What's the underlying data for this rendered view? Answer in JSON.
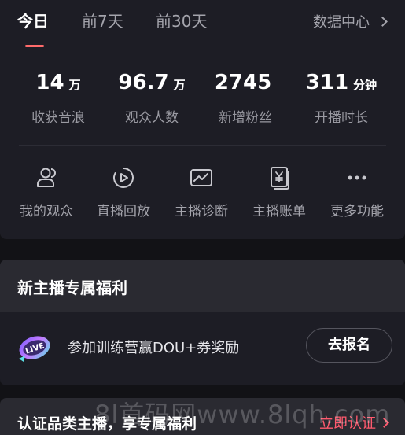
{
  "tabs": [
    {
      "label": "今日",
      "active": true
    },
    {
      "label": "前7天",
      "active": false
    },
    {
      "label": "前30天",
      "active": false
    }
  ],
  "data_center": {
    "label": "数据中心"
  },
  "stats": [
    {
      "value": "14",
      "unit": "万",
      "label": "收获音浪"
    },
    {
      "value": "96.7",
      "unit": "万",
      "label": "观众人数"
    },
    {
      "value": "2745",
      "unit": "",
      "label": "新增粉丝"
    },
    {
      "value": "311",
      "unit": "分钟",
      "label": "开播时长"
    }
  ],
  "functions": [
    {
      "label": "我的观众",
      "icon": "audience-icon"
    },
    {
      "label": "直播回放",
      "icon": "replay-icon"
    },
    {
      "label": "主播诊断",
      "icon": "diagnosis-icon"
    },
    {
      "label": "主播账单",
      "icon": "bill-icon"
    },
    {
      "label": "更多功能",
      "icon": "more-icon"
    }
  ],
  "welfare": {
    "title": "新主播专属福利",
    "badge_text": "LIVE",
    "item_text": "参加训练营赢DOU+券奖励",
    "button_label": "去报名"
  },
  "certification": {
    "text": "认证品类主播，享专属福利",
    "link_label": "立即认证"
  },
  "watermark": "8l首码网www.8lqh.com",
  "colors": {
    "background": "#121216",
    "card": "#1d1d25",
    "accent_underline": "#ff6b6b",
    "link_red": "#ff5a6e",
    "muted_text": "#a4a4ac"
  }
}
